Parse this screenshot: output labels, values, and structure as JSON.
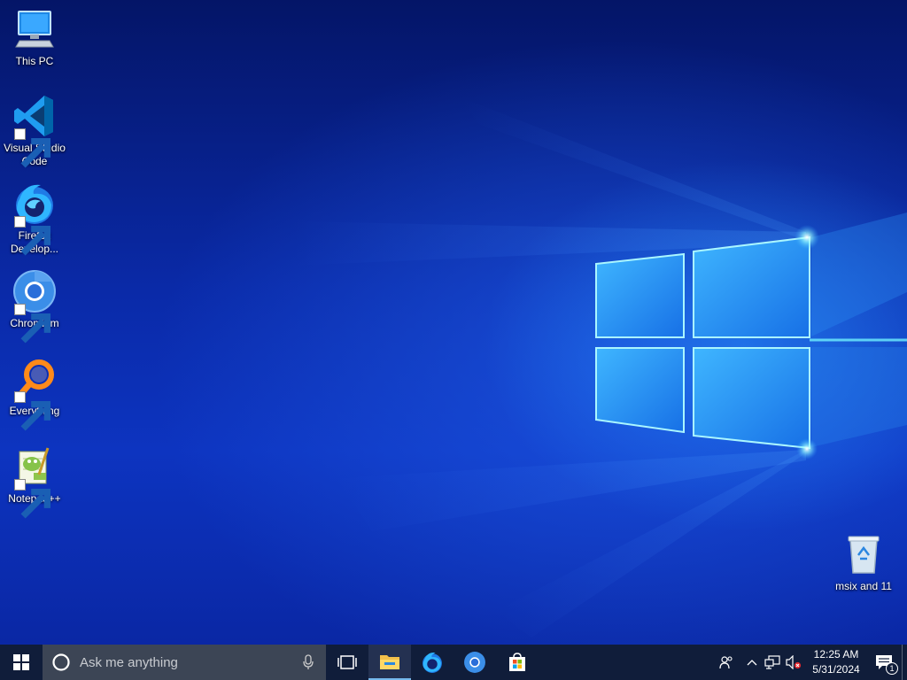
{
  "desktop": {
    "icons": [
      {
        "label": "This PC",
        "icon": "computer-icon"
      },
      {
        "label": "Visual Studio Code",
        "icon": "vscode-icon"
      },
      {
        "label": "Firefox Develop...",
        "icon": "firefox-developer-icon"
      },
      {
        "label": "Chromium",
        "icon": "chromium-icon"
      },
      {
        "label": "Everything",
        "icon": "everything-search-icon"
      },
      {
        "label": "Notepad++",
        "icon": "notepad-plus-plus-icon"
      },
      {
        "label": "msix and 11",
        "icon": "recycle-bin-icon"
      }
    ]
  },
  "taskbar": {
    "search_placeholder": "Ask me anything",
    "pinned": [
      {
        "name": "task-view",
        "icon": "task-view-icon"
      },
      {
        "name": "file-explorer",
        "icon": "folder-icon",
        "active": true
      },
      {
        "name": "firefox-developer",
        "icon": "firefox-developer-icon"
      },
      {
        "name": "chromium",
        "icon": "chromium-icon"
      },
      {
        "name": "microsoft-store",
        "icon": "store-icon"
      }
    ],
    "tray": {
      "time": "12:25 AM",
      "date": "5/31/2024",
      "notification_count": "1"
    }
  },
  "colors": {
    "taskbar": "#101d3a",
    "search_box": "#3c4555",
    "active_indicator": "#76b9ed",
    "wallpaper_blue": "#0a2aa8",
    "logo_glow": "#6ff0ff"
  }
}
